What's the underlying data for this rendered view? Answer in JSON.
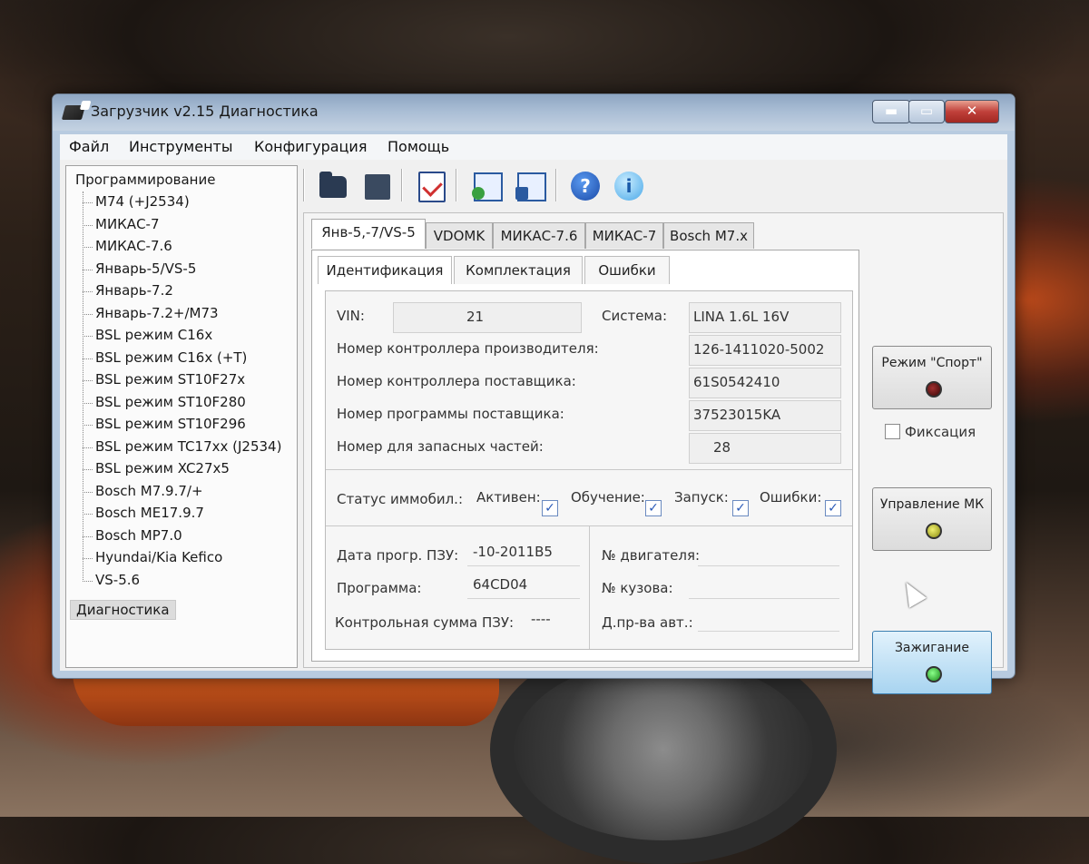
{
  "window": {
    "title": "Загрузчик v2.15 Диагностика",
    "controls": {
      "minimize": "▬",
      "maximize": "▭",
      "close": "✕"
    }
  },
  "menu": [
    "Файл",
    "Инструменты",
    "Конфигурация",
    "Помощь"
  ],
  "tree": {
    "root": "Программирование",
    "items": [
      "M74 (+J2534)",
      "МИКАС-7",
      "МИКАС-7.6",
      "Январь-5/VS-5",
      "Январь-7.2",
      "Январь-7.2+/M73",
      "BSL режим C16x",
      "BSL режим C16x (+T)",
      "BSL режим ST10F27x",
      "BSL режим ST10F280",
      "BSL режим ST10F296",
      "BSL режим TC17xx (J2534)",
      "BSL режим XC27x5",
      "Bosch M7.9.7/+",
      "Bosch ME17.9.7",
      "Bosch MP7.0",
      "Hyundai/Kia Kefico",
      "VS-5.6"
    ],
    "selected": "Диагностика"
  },
  "toolbar": {
    "icons": [
      "open-icon",
      "stop-icon",
      "report-icon",
      "read-icon",
      "write-icon",
      "help-icon",
      "info-icon"
    ],
    "help_glyph": "?",
    "info_glyph": "i"
  },
  "tabs": [
    "Янв-5,-7/VS-5",
    "VDOMK",
    "МИКАС-7.6",
    "МИКАС-7",
    "Bosch M7.x"
  ],
  "subtabs": [
    "Идентификация",
    "Комплектация",
    "Ошибки"
  ],
  "ident": {
    "vin_label": "VIN:",
    "vin_value": "21",
    "system_label": "Система:",
    "system_value": "LINA 1.6L 16V",
    "mfr_ctrl_label": "Номер контроллера производителя:",
    "mfr_ctrl_value": "126-1411020-5002",
    "sup_ctrl_label": "Номер контроллера поставщика:",
    "sup_ctrl_value": "61S0542410",
    "sup_prog_label": "Номер программы поставщика:",
    "sup_prog_value": "37523015KA",
    "spare_label": "Номер для запасных частей:",
    "spare_value": "28"
  },
  "immo": {
    "label": "Статус иммобил.:",
    "active": "Активен:",
    "learning": "Обучение:",
    "start": "Запуск:",
    "errors": "Ошибки:",
    "check": "✓"
  },
  "prog": {
    "date_label": "Дата прогр. ПЗУ:",
    "date_value": "-10-2011B5",
    "program_label": "Программа:",
    "program_value": "64CD04",
    "checksum_label": "Контрольная сумма ПЗУ:",
    "checksum_value": "----",
    "engine_label": "№ двигателя:",
    "body_label": "№ кузова:",
    "date_auto_label": "Д.пр-ва авт.:"
  },
  "side": {
    "sport_label": "Режим \"Спорт\"",
    "fix_label": "Фиксация",
    "mk_label": "Управление МК",
    "ignition_label": "Зажигание"
  },
  "colors": {
    "led_red": "#5a1010",
    "led_yellow": "#c8c83a",
    "led_green": "#3ab83a"
  }
}
